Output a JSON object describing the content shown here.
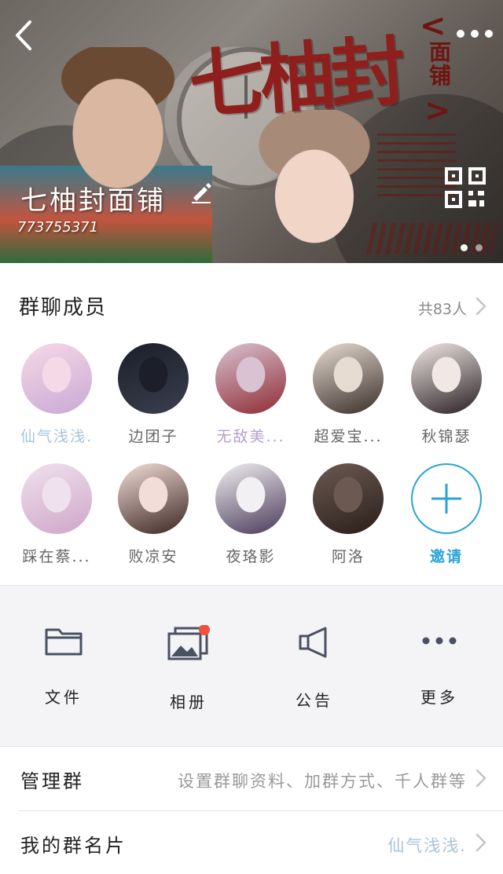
{
  "header": {
    "group_name": "七柚封面铺",
    "group_id": "773755371",
    "banner_title": "七柚封",
    "banner_bracket_open": "<",
    "banner_bracket_close": ">",
    "banner_side_text": "面铺",
    "back_icon": "chevron-left-icon",
    "more_icon": "ellipsis-icon",
    "edit_icon": "pencil-icon",
    "qr_icon": "qr-code-icon",
    "carousel_pages": 2,
    "carousel_active": 0
  },
  "members": {
    "title": "群聊成员",
    "count_text": "共83人",
    "list": [
      {
        "name": "仙气浅浅.",
        "color": "#a8c4d8",
        "swatch": [
          "#f6d9e6",
          "#c9a9d6"
        ]
      },
      {
        "name": "边团子",
        "color": "#666666",
        "swatch": [
          "#1c1f2a",
          "#3a3f4e"
        ]
      },
      {
        "name": "无敌美...",
        "color": "#b5a0cc",
        "swatch": [
          "#d9c2d2",
          "#8f2c34"
        ]
      },
      {
        "name": "超爱宝...",
        "color": "#666666",
        "swatch": [
          "#e7dcd2",
          "#3a2e2a"
        ]
      },
      {
        "name": "秋锦瑟",
        "color": "#666666",
        "swatch": [
          "#f1e8e6",
          "#2a2024"
        ]
      },
      {
        "name": "踩在蔡...",
        "color": "#666666",
        "swatch": [
          "#efe2ee",
          "#cfa6c8"
        ]
      },
      {
        "name": "败凉安",
        "color": "#666666",
        "swatch": [
          "#f3ddd8",
          "#3b2622"
        ]
      },
      {
        "name": "夜珞影",
        "color": "#666666",
        "swatch": [
          "#f2f0f2",
          "#4a3a5a"
        ]
      },
      {
        "name": "阿洛",
        "color": "#666666",
        "swatch": [
          "#6c5a52",
          "#2a1e1a"
        ]
      }
    ],
    "invite_label": "邀请",
    "invite_color": "#2aa3d8"
  },
  "features": [
    {
      "label": "文件",
      "icon": "folder-icon"
    },
    {
      "label": "相册",
      "icon": "photo-album-icon",
      "badge": true
    },
    {
      "label": "公告",
      "icon": "megaphone-icon"
    },
    {
      "label": "更多",
      "icon": "ellipsis-icon"
    }
  ],
  "rows": {
    "manage": {
      "title": "管理群",
      "value": "设置群聊资料、加群方式、千人群等"
    },
    "card": {
      "title": "我的群名片",
      "value": "仙气浅浅."
    }
  },
  "colors": {
    "accent": "#2aa3d8",
    "badge": "#f0503c",
    "muted": "#999999"
  }
}
